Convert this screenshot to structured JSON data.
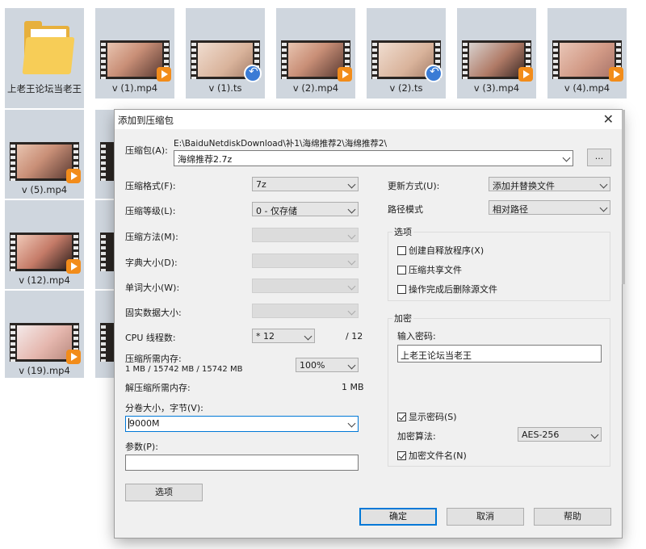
{
  "files": [
    {
      "name": "上老王论坛当老王",
      "type": "folder"
    },
    {
      "name": "v (1).mp4",
      "type": "mp4"
    },
    {
      "name": "v (1).ts",
      "type": "ts"
    },
    {
      "name": "v (2).mp4",
      "type": "mp4"
    },
    {
      "name": "v (2).ts",
      "type": "ts"
    },
    {
      "name": "v (3).mp4",
      "type": "mp4"
    },
    {
      "name": "v (4).mp4",
      "type": "mp4"
    },
    {
      "name": "v (5).mp4",
      "type": "mp4"
    },
    {
      "name": "v (12).mp4",
      "type": "mp4"
    },
    {
      "name": "v (19).mp4",
      "type": "mp4"
    }
  ],
  "dialog": {
    "title": "添加到压缩包",
    "close": "✕",
    "archive_label": "压缩包(A):",
    "archive_path": "E:\\BaiduNetdiskDownload\\补1\\海绵推荐2\\海绵推荐2\\",
    "archive_name": "海绵推荐2.7z",
    "browse": "...",
    "format_label": "压缩格式(F):",
    "format_value": "7z",
    "level_label": "压缩等级(L):",
    "level_value": "0 - 仅存储",
    "method_label": "压缩方法(M):",
    "dict_label": "字典大小(D):",
    "word_label": "单词大小(W):",
    "solid_label": "固实数据大小:",
    "cpu_label": "CPU 线程数:",
    "cpu_value": "* 12",
    "cpu_total": "/ 12",
    "mem_label": "压缩所需内存:",
    "mem_detail": "1 MB / 15742 MB / 15742 MB",
    "mem_percent": "100%",
    "decomp_label": "解压缩所需内存:",
    "decomp_value": "1 MB",
    "volume_label": "分卷大小，字节(V):",
    "volume_value": "9000M",
    "params_label": "参数(P):",
    "params_value": "",
    "options_button": "选项",
    "update_label": "更新方式(U):",
    "update_value": "添加并替换文件",
    "path_label": "路径模式",
    "path_value": "相对路径",
    "options_group": "选项",
    "opt_sfx": "创建自释放程序(X)",
    "opt_shared": "压缩共享文件",
    "opt_delete": "操作完成后删除源文件",
    "encrypt_group": "加密",
    "password_label": "输入密码:",
    "password_value": "上老王论坛当老王",
    "show_password": "显示密码(S)",
    "enc_method_label": "加密算法:",
    "enc_method_value": "AES-256",
    "encrypt_names": "加密文件名(N)",
    "ok": "确定",
    "cancel": "取消",
    "help": "帮助"
  }
}
